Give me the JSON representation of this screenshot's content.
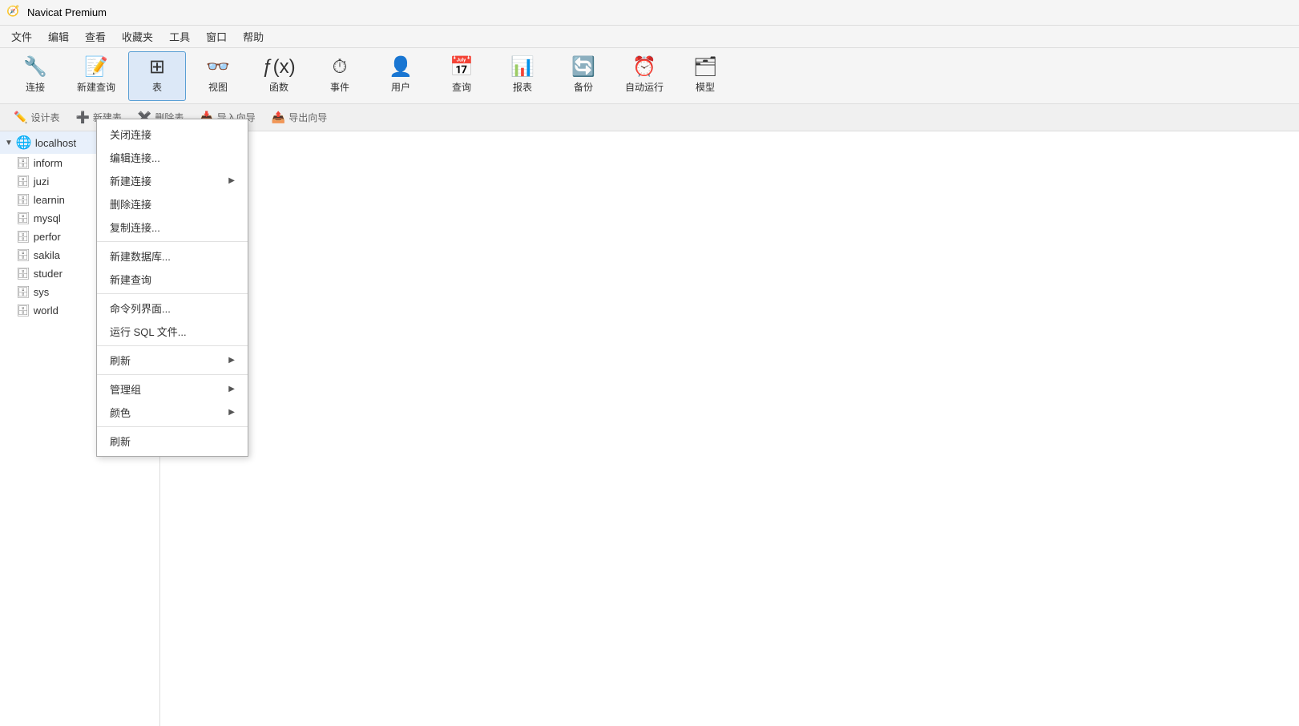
{
  "app": {
    "title": "Navicat Premium"
  },
  "menubar": {
    "items": [
      "文件",
      "编辑",
      "查看",
      "收藏夹",
      "工具",
      "窗口",
      "帮助"
    ]
  },
  "toolbar": {
    "buttons": [
      {
        "id": "connect",
        "label": "连接",
        "icon": "🔌"
      },
      {
        "id": "new-query",
        "label": "新建查询",
        "icon": "📋"
      },
      {
        "id": "table",
        "label": "表",
        "icon": "📊",
        "active": true
      },
      {
        "id": "view",
        "label": "视图",
        "icon": "👓"
      },
      {
        "id": "function",
        "label": "函数",
        "icon": "ƒ(x)"
      },
      {
        "id": "event",
        "label": "事件",
        "icon": "⏱"
      },
      {
        "id": "user",
        "label": "用户",
        "icon": "👤"
      },
      {
        "id": "query",
        "label": "查询",
        "icon": "📅"
      },
      {
        "id": "report",
        "label": "报表",
        "icon": "📊"
      },
      {
        "id": "backup",
        "label": "备份",
        "icon": "🔄"
      },
      {
        "id": "autorun",
        "label": "自动运行",
        "icon": "⏰"
      },
      {
        "id": "model",
        "label": "模型",
        "icon": "🗂"
      }
    ]
  },
  "subtoolbar": {
    "buttons": [
      {
        "id": "design-table",
        "label": "设计表",
        "icon": "✏️"
      },
      {
        "id": "new-table",
        "label": "新建表",
        "icon": "➕"
      },
      {
        "id": "delete-table",
        "label": "删除表",
        "icon": "✖️"
      },
      {
        "id": "import-wizard",
        "label": "导入向导",
        "icon": "📥"
      },
      {
        "id": "export-wizard",
        "label": "导出向导",
        "icon": "📤"
      }
    ]
  },
  "sidebar": {
    "connection_label": "localhost",
    "databases": [
      {
        "id": "inform",
        "name": "inform"
      },
      {
        "id": "juzi",
        "name": "juzi"
      },
      {
        "id": "learning",
        "name": "learnin"
      },
      {
        "id": "mysql",
        "name": "mysql"
      },
      {
        "id": "perfor",
        "name": "perfor"
      },
      {
        "id": "sakila",
        "name": "sakila"
      },
      {
        "id": "student",
        "name": "studer"
      },
      {
        "id": "sys",
        "name": "sys"
      },
      {
        "id": "world",
        "name": "world"
      }
    ]
  },
  "context_menu": {
    "items": [
      {
        "id": "close-conn",
        "label": "关闭连接",
        "has_submenu": false
      },
      {
        "id": "edit-conn",
        "label": "编辑连接...",
        "has_submenu": false
      },
      {
        "id": "new-conn",
        "label": "新建连接",
        "has_submenu": true
      },
      {
        "id": "delete-conn",
        "label": "删除连接",
        "has_submenu": false
      },
      {
        "id": "copy-conn",
        "label": "复制连接...",
        "has_submenu": false
      },
      {
        "separator1": true
      },
      {
        "id": "new-database",
        "label": "新建数据库...",
        "has_submenu": false
      },
      {
        "id": "new-query-ctx",
        "label": "新建查询",
        "has_submenu": false
      },
      {
        "separator2": true
      },
      {
        "id": "command-line",
        "label": "命令列界面...",
        "has_submenu": false
      },
      {
        "id": "run-sql",
        "label": "运行 SQL 文件...",
        "has_submenu": false
      },
      {
        "separator3": true
      },
      {
        "id": "refresh",
        "label": "刷新",
        "has_submenu": true
      },
      {
        "separator4": true
      },
      {
        "id": "manage-group",
        "label": "管理组",
        "has_submenu": true
      },
      {
        "id": "color",
        "label": "颜色",
        "has_submenu": true
      },
      {
        "separator5": true
      },
      {
        "id": "refresh2",
        "label": "刷新",
        "has_submenu": false
      }
    ]
  }
}
